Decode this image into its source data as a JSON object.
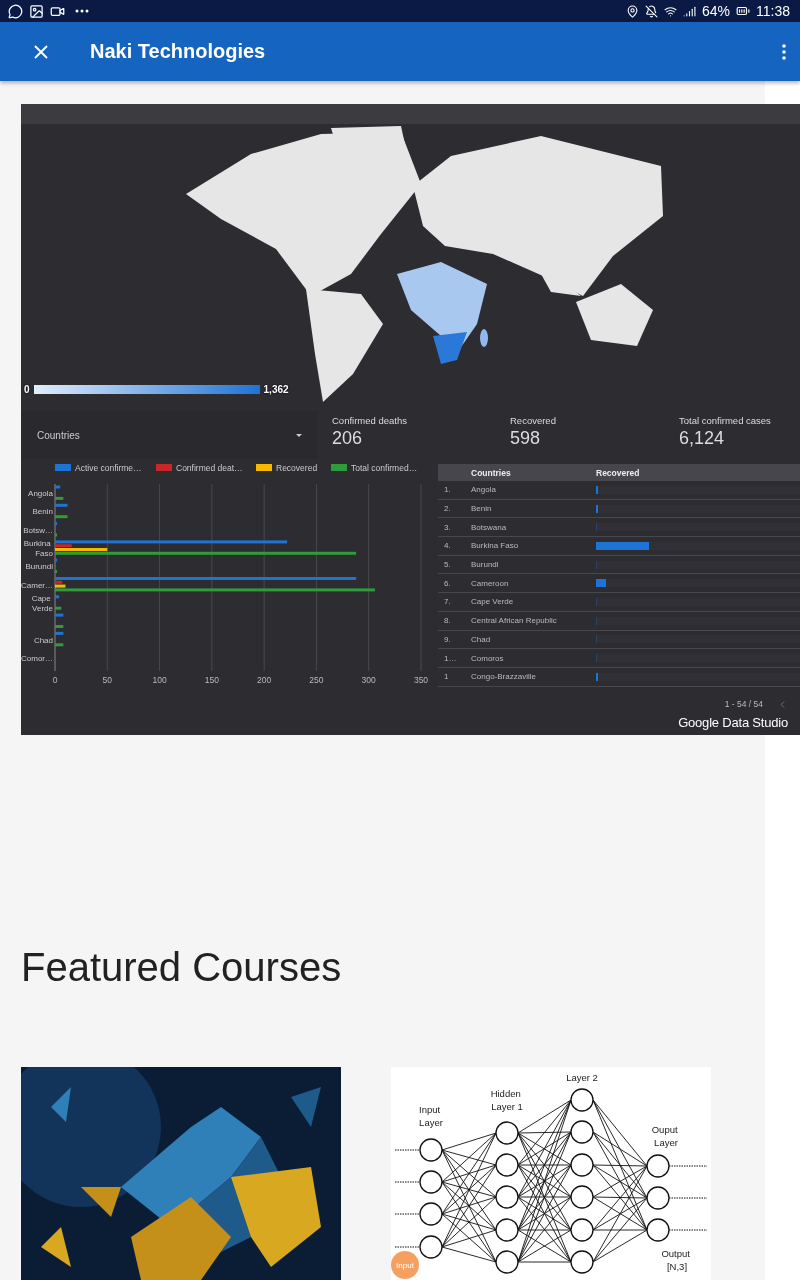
{
  "status_bar": {
    "battery": "64%",
    "time": "11:38"
  },
  "app_bar": {
    "title": "Naki Technologies"
  },
  "dashboard": {
    "map": {
      "kind": "picture",
      "legend_min": "0",
      "legend_max": "1,362"
    },
    "filter": {
      "label": "Countries"
    },
    "scorecards": [
      {
        "label": "Confirmed deaths",
        "value": "206"
      },
      {
        "label": "Recovered",
        "value": "598"
      },
      {
        "label": "Total confirmed cases",
        "value": "6,124"
      }
    ],
    "bar_chart": {
      "chart_data": {
        "type": "bar",
        "orientation": "horizontal",
        "grid": true,
        "legend": true,
        "categories": [
          "Angola",
          "Benin",
          "Botsw…",
          "Burkina Faso",
          "Burundi",
          "Camer…",
          "Cape Verde",
          null,
          "Chad",
          "Comor…"
        ],
        "xlim": [
          0,
          350
        ],
        "xticks": [
          0,
          50,
          100,
          150,
          200,
          250,
          300,
          350
        ],
        "series": [
          {
            "name": "Active confirme…",
            "color": "#1e73d6",
            "values": [
              5,
              12,
              2,
              222,
              2,
              288,
              4,
              8,
              8,
              0
            ]
          },
          {
            "name": "Confirmed deat…",
            "color": "#c62828",
            "values": [
              0,
              0,
              0,
              16,
              0,
              7,
              0,
              0,
              0,
              0
            ]
          },
          {
            "name": "Recovered",
            "color": "#f9b800",
            "values": [
              0,
              0,
              0,
              50,
              0,
              10,
              0,
              0,
              0,
              0
            ]
          },
          {
            "name": "Total confirmed…",
            "color": "#2e9c3a",
            "values": [
              8,
              12,
              2,
              288,
              2,
              306,
              6,
              8,
              8,
              0
            ]
          }
        ]
      }
    },
    "table": {
      "columns": [
        "Countries",
        "Recovered"
      ],
      "rows": [
        {
          "rank": "1.",
          "country": "Angola",
          "level": 0.008
        },
        {
          "rank": "2.",
          "country": "Benin",
          "level": 0.008
        },
        {
          "rank": "3.",
          "country": "Botswana",
          "level": 0
        },
        {
          "rank": "4.",
          "country": "Burkina Faso",
          "level": 0.26
        },
        {
          "rank": "5.",
          "country": "Burundi",
          "level": 0
        },
        {
          "rank": "6.",
          "country": "Cameroon",
          "level": 0.05
        },
        {
          "rank": "7.",
          "country": "Cape Verde",
          "level": 0
        },
        {
          "rank": "8.",
          "country": "Central African Republic",
          "level": 0
        },
        {
          "rank": "9.",
          "country": "Chad",
          "level": 0
        },
        {
          "rank": "1…",
          "country": "Comoros",
          "level": 0
        },
        {
          "rank": "1",
          "country": "Congo-Brazzaville",
          "level": 0.01
        }
      ],
      "pagination": "1 - 54 / 54"
    },
    "footer_logo": "Google Data Studio"
  },
  "featured": {
    "heading": "Featured Courses",
    "courses": [
      {
        "kind": "picture"
      },
      {
        "kind": "diagram",
        "labels": [
          "Input Layer",
          "Hidden Layer 1",
          "Layer 2",
          "Ouput Layer",
          "Output [N,3]"
        ],
        "badge": "Input"
      }
    ]
  }
}
